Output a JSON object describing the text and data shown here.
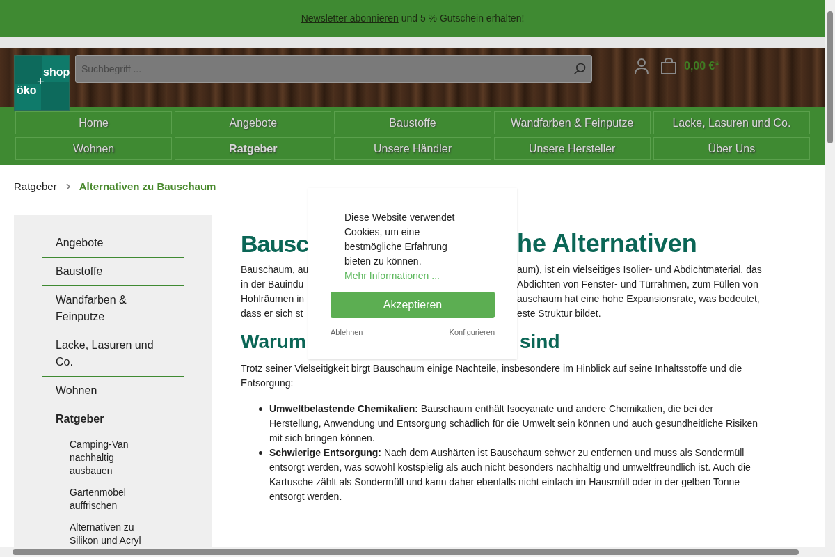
{
  "promo_bar": {
    "link": "Newsletter abonnieren",
    "text": " und 5 % Gutschein erhalten!"
  },
  "header": {
    "logo": {
      "left": "öko",
      "right": "shop",
      "plus": "+"
    },
    "search": {
      "placeholder": "Suchbegriff ..."
    },
    "cart_total": "0,00 €*"
  },
  "nav": [
    {
      "label": "Home",
      "selected": false
    },
    {
      "label": "Angebote",
      "selected": false
    },
    {
      "label": "Baustoffe",
      "selected": false
    },
    {
      "label": "Wandfarben & Feinputze",
      "selected": false
    },
    {
      "label": "Lacke, Lasuren und Co.",
      "selected": false
    },
    {
      "label": "Wohnen",
      "selected": false
    },
    {
      "label": "Ratgeber",
      "selected": true
    },
    {
      "label": "Unsere Händler",
      "selected": false
    },
    {
      "label": "Unsere Hersteller",
      "selected": false
    },
    {
      "label": "Über Uns",
      "selected": false
    }
  ],
  "breadcrumb": [
    "Ratgeber",
    "Alternativen zu Bauschaum"
  ],
  "sidebar": {
    "items": [
      {
        "label": "Angebote",
        "selected": false,
        "expanded": false
      },
      {
        "label": "Baustoffe",
        "selected": false,
        "expanded": false
      },
      {
        "label": "Wandfarben & Feinputze",
        "selected": false,
        "expanded": false
      },
      {
        "label": "Lacke, Lasuren und Co.",
        "selected": false,
        "expanded": false
      },
      {
        "label": "Wohnen",
        "selected": false,
        "expanded": false
      },
      {
        "label": "Ratgeber",
        "selected": true,
        "expanded": true,
        "children": [
          {
            "label": "Camping-Van nachhaltig ausbauen"
          },
          {
            "label": "Gartenmöbel auffrischen"
          },
          {
            "label": "Alternativen zu Silikon und Acryl"
          }
        ]
      }
    ]
  },
  "article": {
    "heading": {
      "left": "Bausc",
      "right": "he Alternativen"
    },
    "intro_lines": [
      {
        "left": "Bauschaum, au",
        "right": "aum), ist ein vielseitiges Isolier- und Abdichtmaterial, das"
      },
      {
        "left": "in der Bauindu",
        "right": "Abdichten von Fenster- und Türrahmen, zum Füllen von"
      },
      {
        "left": "Hohlräumen in",
        "right": "auschaum hat eine hohe Expansionsrate, was bedeutet,"
      },
      {
        "left": "dass er sich st",
        "right": "este Struktur bildet."
      }
    ],
    "subheading": {
      "left": "Warum",
      "right": "sind"
    },
    "paragraph": "Trotz seiner Vielseitigkeit birgt Bauschaum einige Nachteile, insbesondere im Hinblick auf seine Inhaltsstoffe und die Entsorgung:",
    "bullets": [
      "**Umweltbelastende Chemikalien:** Bauschaum enthält Isocyanate und andere Chemikalien, die bei der Herstellung, Anwendung und Entsorgung schädlich für die Umwelt sein können und auch gesundheitliche Risiken mit sich bringen können.",
      "**Schwierige Entsorgung:** Nach dem Aushärten ist Bauschaum schwer zu entfernen und muss als Sondermüll entsorgt werden, was sowohl kostspielig als auch nicht besonders nachhaltig und umweltfreundlich ist. Auch die Kartusche zählt als Sondermüll und kann daher ebenfalls nicht einfach im Hausmüll oder in der gelben Tonne entsorgt werden."
    ]
  },
  "cookie_dialog": {
    "text": "Diese Website verwendet Cookies, um eine bestmögliche Erfahrung bieten zu können.",
    "more_link": "Mehr Informationen ...",
    "accept": "Akzeptieren",
    "decline": "Ablehnen",
    "configure": "Konfigurieren"
  }
}
